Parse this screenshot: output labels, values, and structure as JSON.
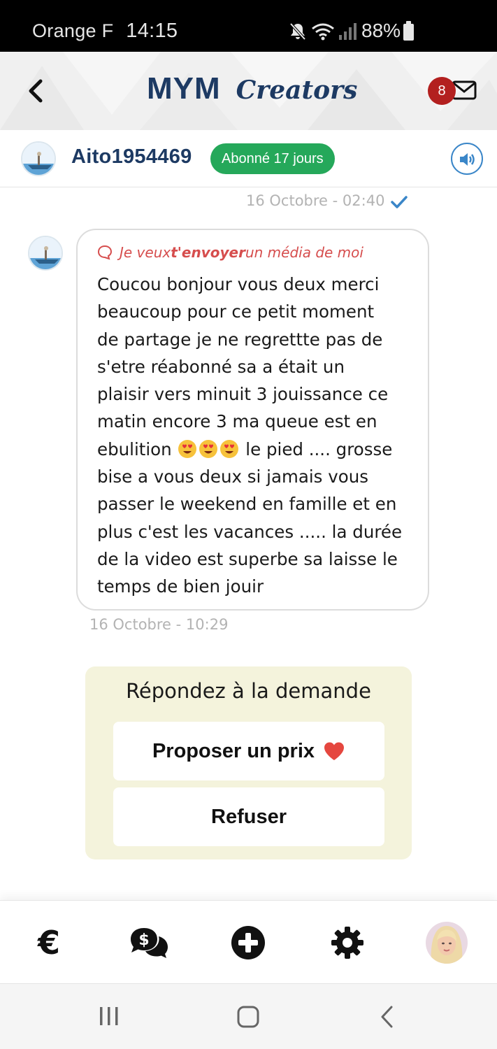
{
  "status_bar": {
    "carrier": "Orange F",
    "time": "14:15",
    "battery": "88%"
  },
  "header": {
    "logo_mym": "MYM",
    "logo_creators": "Creators",
    "notification_count": "8"
  },
  "profile": {
    "username": "Aito1954469",
    "subscription_badge": "Abonné 17 jours"
  },
  "chat": {
    "top_timestamp": "16 Octobre - 02:40",
    "message": {
      "request_prefix": "Je veux ",
      "request_strong": "t'envoyer",
      "request_suffix": " un média de moi",
      "lines": [
        "Coucou bonjour vous deux merci",
        "beaucoup pour ce petit moment",
        "de partage je ne regrettte pas de",
        "s'etre réabonné sa a était un",
        "plaisir vers minuit 3 jouissance ce",
        "matin encore 3 ma queue est en"
      ],
      "emoji_line_before": "ebulition ",
      "emoji_line_after": "le pied .... grosse",
      "lines_after": [
        "bise a vous deux si jamais vous",
        "passer le weekend en famille et en",
        "plus c'est les vacances ..... la durée",
        "de la video est superbe sa laisse le",
        "temps de bien jouir"
      ],
      "timestamp": "16 Octobre - 10:29"
    }
  },
  "request_panel": {
    "title": "Répondez à la demande",
    "propose_label": "Proposer un prix",
    "refuse_label": "Refuser"
  },
  "bottom_nav": {
    "euro_glyph": "€",
    "items": [
      "euro-icon",
      "messages-dollar-icon",
      "add-circle-icon",
      "gear-icon",
      "profile-avatar"
    ]
  },
  "colors": {
    "brand_navy": "#1d3a63",
    "badge_red": "#b3201f",
    "green": "#25a85a",
    "request_red": "#d64d4d",
    "panel_bg": "#f4f3dc",
    "accent_blue": "#3a86c8"
  }
}
